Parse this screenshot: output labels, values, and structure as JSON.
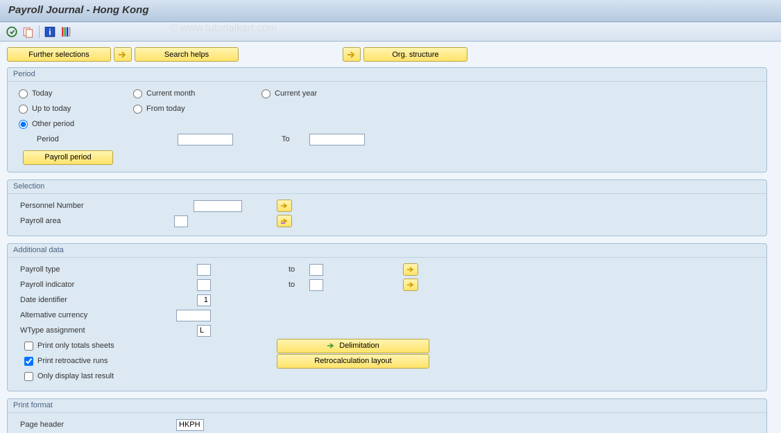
{
  "title": "Payroll Journal - Hong Kong",
  "watermark": "© www.tutorialkart.com",
  "topButtons": {
    "further_selections": "Further selections",
    "search_helps": "Search helps",
    "org_structure": "Org. structure"
  },
  "period": {
    "title": "Period",
    "today": "Today",
    "current_month": "Current month",
    "current_year": "Current year",
    "up_to_today": "Up to today",
    "from_today": "From today",
    "other_period": "Other period",
    "period_label": "Period",
    "to_label": "To",
    "payroll_period_btn": "Payroll period",
    "period_value": "",
    "to_value": ""
  },
  "selection": {
    "title": "Selection",
    "personnel_number": "Personnel Number",
    "payroll_area": "Payroll area",
    "personnel_value": "",
    "payroll_area_value": ""
  },
  "additional": {
    "title": "Additional data",
    "payroll_type": "Payroll type",
    "payroll_indicator": "Payroll indicator",
    "date_identifier": "Date identifier",
    "date_identifier_value": "1",
    "alternative_currency": "Alternative currency",
    "wtype_assignment": "WType assignment",
    "wtype_value": "L",
    "to_label": "to",
    "print_only_totals": "Print only totals sheets",
    "print_retro": "Print retroactive runs",
    "only_display_last": "Only display last result",
    "delimitation_btn": "Delimitation",
    "retro_layout_btn": "Retrocalculation layout"
  },
  "print_format": {
    "title": "Print format",
    "page_header": "Page header",
    "page_header_value": "HKPH"
  }
}
